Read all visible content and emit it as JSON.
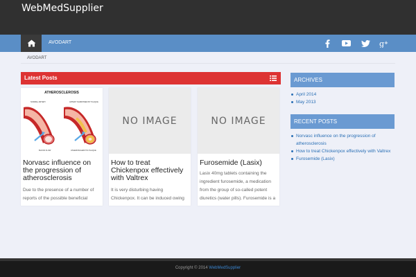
{
  "site": {
    "title": "WebMedSupplier"
  },
  "nav": {
    "home_icon": "home-icon",
    "items": [
      {
        "label": "AVODART"
      }
    ],
    "social": [
      "facebook-icon",
      "youtube-icon",
      "twitter-icon",
      "google-plus-icon"
    ]
  },
  "breadcrumb": {
    "current": "AVODART"
  },
  "latest": {
    "heading": "Latest Posts",
    "posts": [
      {
        "thumb": "atherosclerosis-illustration",
        "thumb_title": "ATHEROSCLEROSIS",
        "thumb_label_1": "NORMAL ARTERY",
        "thumb_label_2": "ARTERY NARROWED BY PLAQUE",
        "thumb_label_3": "BLOOD FLOW",
        "thumb_label_4": "ATHEROSCLEROTIC PLAQUE",
        "title": "Norvasc influence on the progression of atherosclerosis",
        "excerpt": "Due to the presence of a number of reports of the possible beneficial"
      },
      {
        "thumb": "NO IMAGE",
        "title": "How to treat Chickenpox effectively with Valtrex",
        "excerpt": "It is very disturbing having Chickenpox. It can be induced owing"
      },
      {
        "thumb": "NO IMAGE",
        "title": "Furosemide (Lasix)",
        "excerpt": "Lasix 40mg tablets containing the ingredient furosemide, a medication from the group of so-called potent diuretics (water pills). Furosemide is a"
      }
    ]
  },
  "sidebar": {
    "archives": {
      "heading": "ARCHIVES",
      "items": [
        "April 2014",
        "May 2013"
      ]
    },
    "recent": {
      "heading": "RECENT POSTS",
      "items": [
        "Norvasc influence on the progression of atherosclerosis",
        "How to treat Chickenpox effectively with Valtrex",
        "Furosemide (Lasix)"
      ]
    }
  },
  "footer": {
    "copyright": "Copyright © 2014",
    "link": "WebMedSupplier"
  },
  "colors": {
    "header_bg": "#303030",
    "nav_bg": "#5a8ec6",
    "latest_bar": "#dd3333",
    "widget_head": "#6a9ad2",
    "link": "#2a6fb5"
  }
}
